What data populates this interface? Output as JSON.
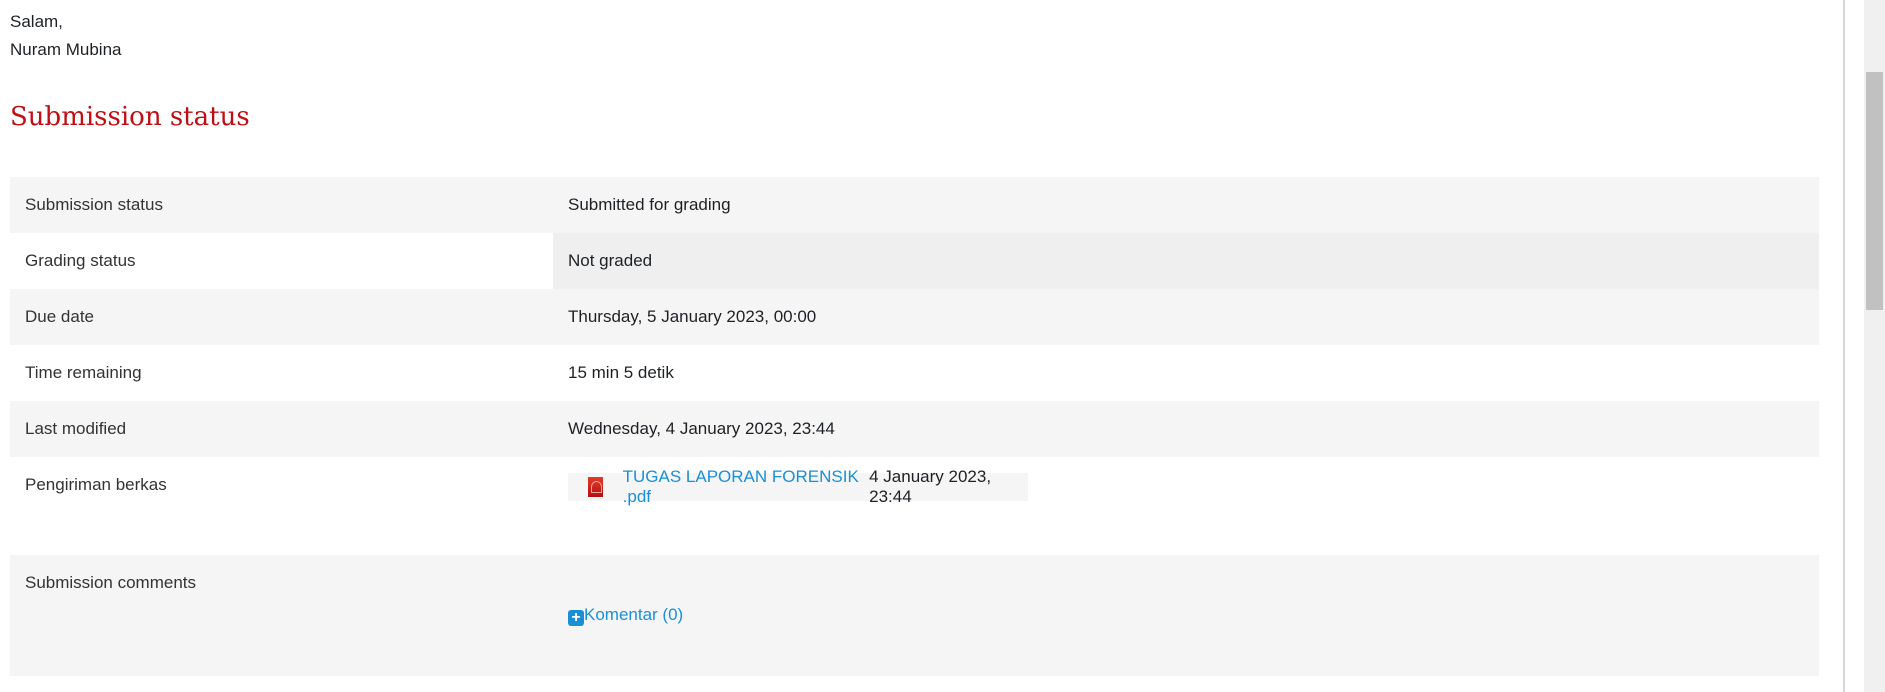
{
  "greeting": {
    "salutation": "Salam,",
    "name": "Nuram Mubina"
  },
  "heading": "Submission status",
  "rows": [
    {
      "label": "Submission status",
      "value": "Submitted for grading"
    },
    {
      "label": "Grading status",
      "value": "Not graded"
    },
    {
      "label": "Due date",
      "value": "Thursday, 5 January 2023, 00:00"
    },
    {
      "label": "Time remaining",
      "value": "15 min 5 detik"
    },
    {
      "label": "Last modified",
      "value": "Wednesday, 4 January 2023, 23:44"
    },
    {
      "label": "Pengiriman berkas",
      "file": {
        "name": "TUGAS LAPORAN FORENSIK .pdf",
        "date": "4 January 2023, 23:44",
        "icon": "pdf-icon"
      }
    },
    {
      "label": "Submission comments",
      "comments_link": "Komentar (0)",
      "icon": "plus-square-icon"
    }
  ]
}
